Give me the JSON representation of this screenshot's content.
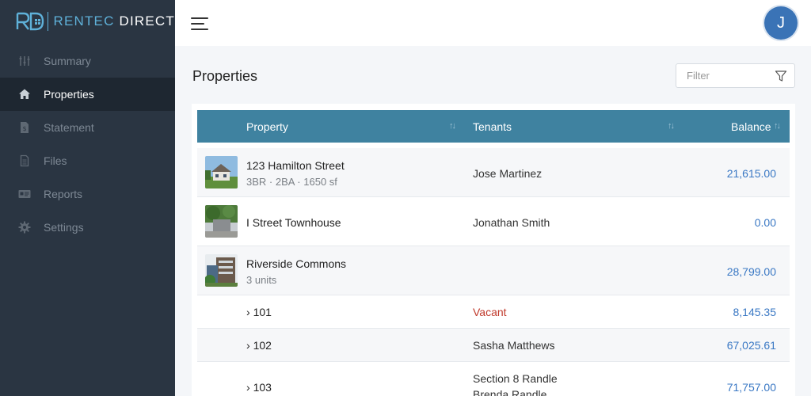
{
  "brand": {
    "name_part1": "RENTEC",
    "name_part2": "DIRECT",
    "accent": "#5fb1d9"
  },
  "sidebar": {
    "items": [
      {
        "label": "Summary",
        "icon": "sliders-icon",
        "active": false
      },
      {
        "label": "Properties",
        "icon": "home-icon",
        "active": true
      },
      {
        "label": "Statement",
        "icon": "dollar-document-icon",
        "active": false
      },
      {
        "label": "Files",
        "icon": "file-icon",
        "active": false
      },
      {
        "label": "Reports",
        "icon": "report-card-icon",
        "active": false
      },
      {
        "label": "Settings",
        "icon": "gear-icon",
        "active": false
      }
    ]
  },
  "topbar": {
    "avatar_initial": "J",
    "avatar_color": "#3a73b6"
  },
  "main": {
    "title": "Properties",
    "filter": {
      "placeholder": "Filter",
      "value": ""
    }
  },
  "table": {
    "header_color": "#3f82a0",
    "columns": {
      "property": "Property",
      "tenants": "Tenants",
      "balance": "Balance"
    },
    "rows": [
      {
        "name": "123 Hamilton Street",
        "sub": "3BR · 2BA · 1650 sf",
        "tenant": "Jose Martinez",
        "balance": "21,615.00"
      },
      {
        "name": "I Street Townhouse",
        "tenant": "Jonathan Smith",
        "balance": "0.00"
      },
      {
        "name": "Riverside Commons",
        "sub": "3 units",
        "tenant": "",
        "balance": "28,799.00"
      }
    ],
    "units": [
      {
        "unit": "101",
        "tenant": "Vacant",
        "balance": "8,145.35"
      },
      {
        "unit": "102",
        "tenant": "Sasha Matthews",
        "balance": "67,025.61"
      },
      {
        "unit": "103",
        "tenant_line1": "Section 8 Randle",
        "tenant_line2": "Brenda Randle",
        "balance": "71,757.00"
      }
    ]
  }
}
